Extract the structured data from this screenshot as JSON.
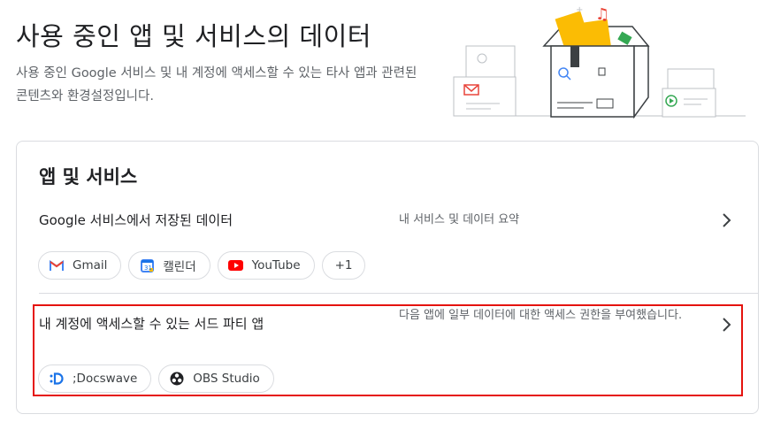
{
  "header": {
    "title": "사용 중인 앱 및 서비스의 데이터",
    "description": "사용 중인 Google 서비스 및 내 계정에 액세스할 수 있는 타사 앱과 관련된 콘텐츠와 환경설정입니다."
  },
  "card": {
    "title": "앱 및 서비스",
    "google_services": {
      "label": "Google 서비스에서 저장된 데이터",
      "description": "내 서비스 및 데이터 요약",
      "chips": [
        {
          "label": "Gmail",
          "icon": "gmail-icon"
        },
        {
          "label": "캘린더",
          "icon": "calendar-icon"
        },
        {
          "label": "YouTube",
          "icon": "youtube-icon"
        },
        {
          "label": "+1",
          "icon": ""
        }
      ]
    },
    "third_party": {
      "label": "내 계정에 액세스할 수 있는 서드 파티 앱",
      "description": "다음 앱에 일부 데이터에 대한 액세스 권한을 부여했습니다.",
      "chips": [
        {
          "label": ";Docswave",
          "icon": "docswave-icon"
        },
        {
          "label": "OBS Studio",
          "icon": "obs-icon"
        }
      ]
    }
  },
  "colors": {
    "highlight": "#e5130e",
    "border": "#dadce0",
    "text_secondary": "#5f6368"
  }
}
